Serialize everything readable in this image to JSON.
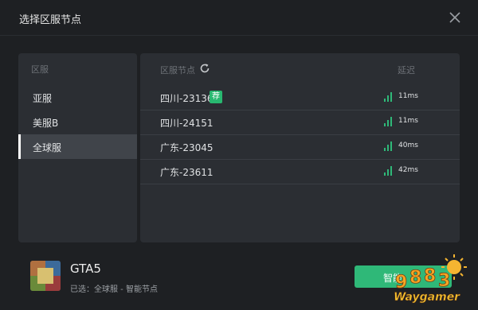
{
  "window": {
    "title": "选择区服节点"
  },
  "regions": {
    "header": "区服",
    "items": [
      {
        "label": "亚服",
        "active": false
      },
      {
        "label": "美服B",
        "active": false
      },
      {
        "label": "全球服",
        "active": true
      }
    ]
  },
  "nodes": {
    "header": "区服节点",
    "latency_header": "延迟",
    "items": [
      {
        "name": "四川-23136",
        "badge": "荐",
        "latency": "11ms"
      },
      {
        "name": "四川-24151",
        "badge": "",
        "latency": "11ms"
      },
      {
        "name": "广东-23045",
        "badge": "",
        "latency": "40ms"
      },
      {
        "name": "广东-23611",
        "badge": "",
        "latency": "42ms"
      }
    ]
  },
  "footer": {
    "game_name": "GTA5",
    "selected_text": "已选：全球服 - 智能节点",
    "button_label": "智能"
  },
  "watermark": {
    "text": "Waygamer"
  },
  "colors": {
    "accent": "#2fb878",
    "signal": "#2fb878",
    "background": "#1e2023",
    "panel": "#2b2e33"
  }
}
